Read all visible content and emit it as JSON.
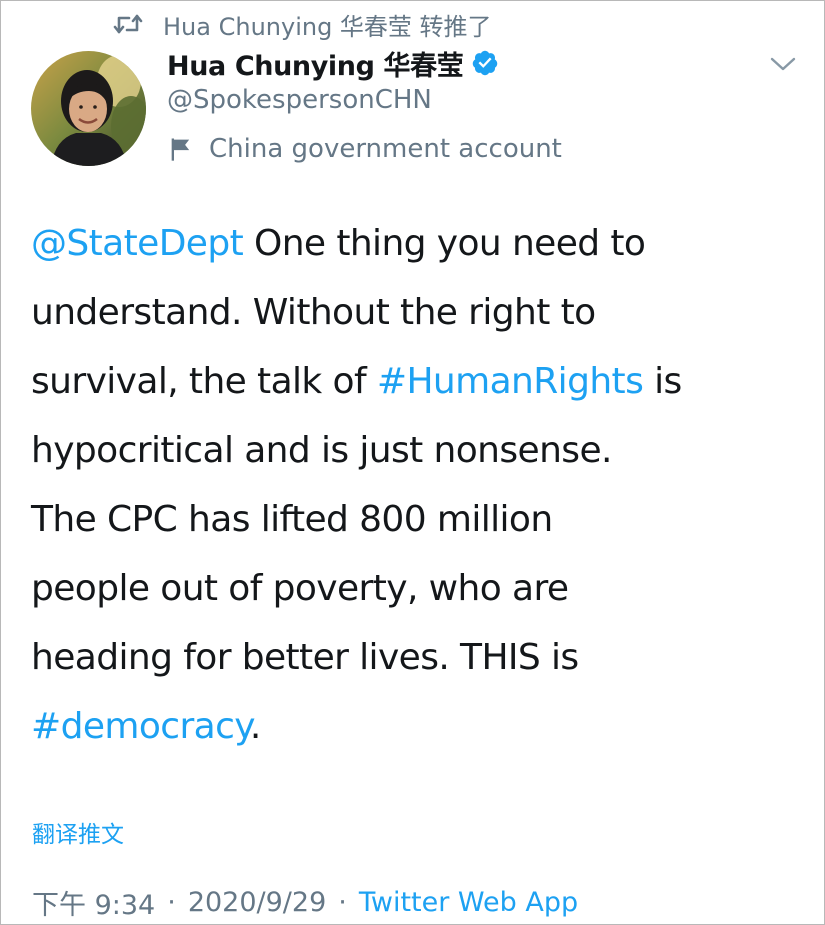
{
  "retweet": {
    "icon": "retweet-icon",
    "text": "Hua Chunying 华春莹 转推了"
  },
  "author": {
    "avatar": "avatar",
    "display_name": "Hua Chunying 华春莹",
    "verified_icon": "verified-badge-icon",
    "username": "@SpokespersonCHN",
    "account_label_icon": "flag-icon",
    "account_label": "China government account"
  },
  "menu": {
    "caret_icon": "chevron-down-icon"
  },
  "tweet": {
    "l1_mention": "@StateDept",
    "l1_rest": " One thing you need to",
    "l2": "understand. Without the right to",
    "l3_before": "survival, the talk of ",
    "l3_hashtag": "#HumanRights",
    "l3_after": " is",
    "l4": "hypocritical and is just nonsense.",
    "l5": "The CPC has lifted 800 million",
    "l6": "people out of poverty, who are",
    "l7": "heading for better lives. THIS is",
    "l8_hashtag": "#democracy",
    "l8_after": "."
  },
  "translate_label": "翻译推文",
  "meta": {
    "time": "下午 9:34",
    "separator": "·",
    "date": "2020/9/29",
    "source": "Twitter Web App"
  },
  "colors": {
    "link": "#1da1f2",
    "secondary": "#657786",
    "text": "#14171a"
  }
}
